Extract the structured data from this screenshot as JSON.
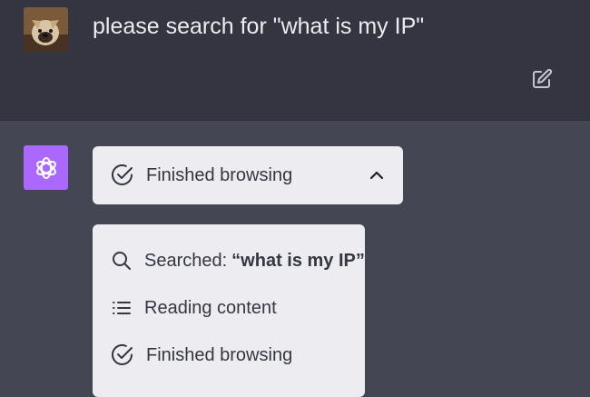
{
  "user": {
    "message": "please search for \"what is my IP\"",
    "avatar_icon": "bulldog-avatar-photo",
    "edit_icon": "edit-icon"
  },
  "assistant": {
    "logo_icon": "openai-logo-icon",
    "logo_color": "#ab68ff",
    "browse_status": "Finished browsing",
    "expanded": true,
    "steps": [
      {
        "icon": "search-icon",
        "label": "Searched:",
        "query": "“what is my IP”"
      },
      {
        "icon": "list-icon",
        "label": "Reading content"
      },
      {
        "icon": "check-circle-icon",
        "label": "Finished browsing"
      }
    ]
  },
  "colors": {
    "user_bg": "#343541",
    "assistant_bg": "#444654",
    "card_bg": "#ececf1",
    "text_dark": "#353740",
    "text_light": "#ececf1"
  }
}
